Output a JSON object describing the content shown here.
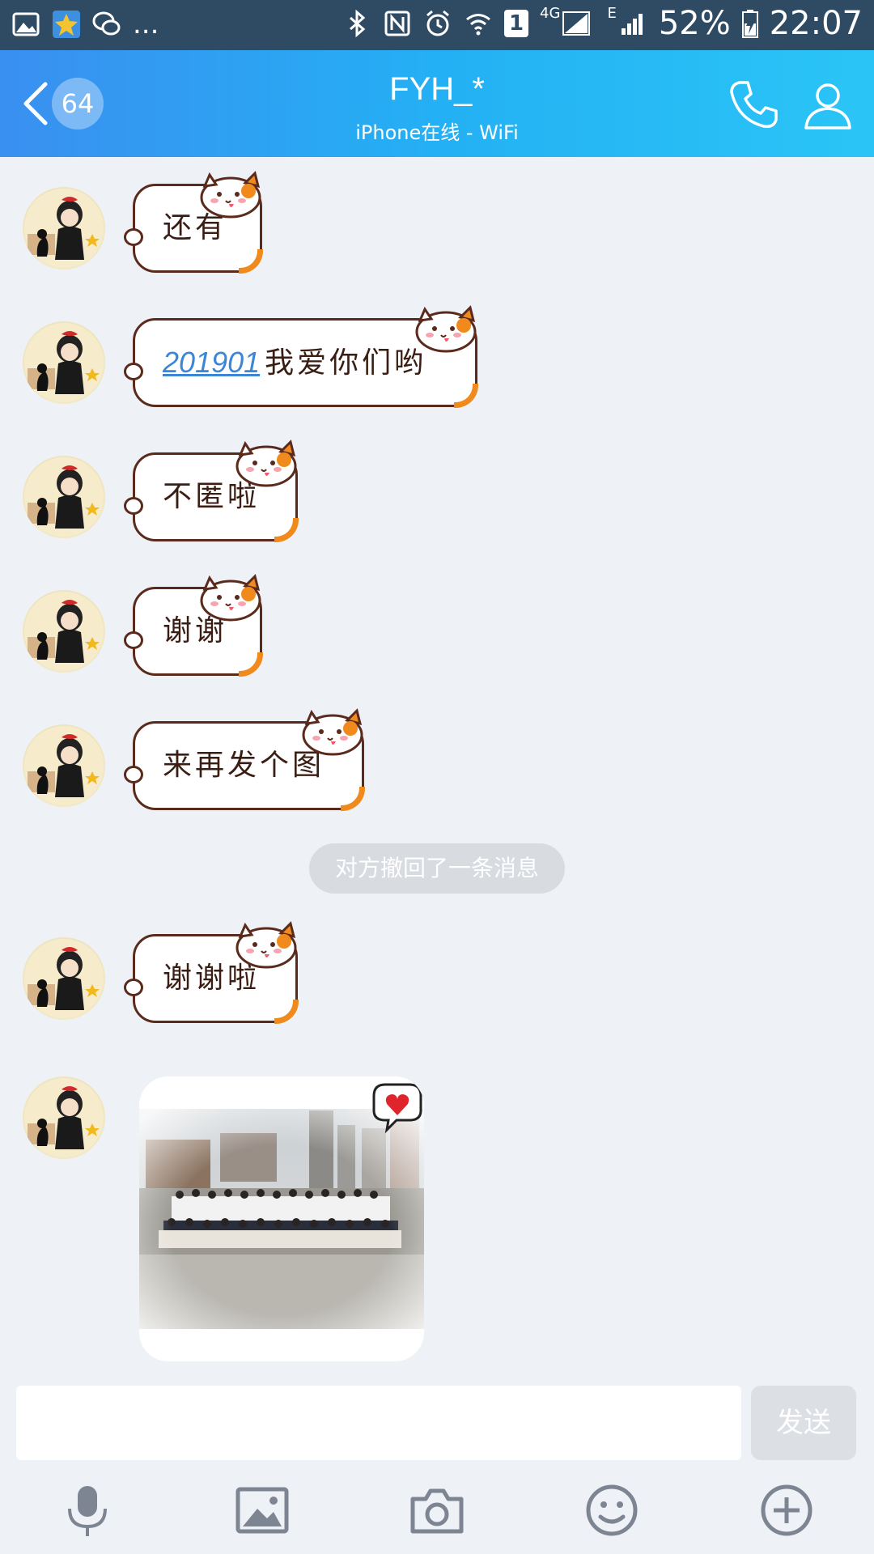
{
  "status_bar": {
    "left_ellipsis": "...",
    "battery_percent": "52%",
    "time": "22:07",
    "network_4g": "4G",
    "network_e": "E",
    "sim_slot": "1",
    "icons": [
      "gallery-icon",
      "starred-app-icon",
      "wechat-icon",
      "bluetooth-icon",
      "nfc-icon",
      "alarm-icon",
      "wifi-icon",
      "signal-icon",
      "battery-icon"
    ]
  },
  "header": {
    "unread_count": "64",
    "title": "FYH_*",
    "subtitle": "iPhone在线 - WiFi",
    "icons": [
      "back-icon",
      "phone-icon",
      "profile-icon"
    ],
    "gradient": [
      "#3a8ff0",
      "#2ac5f6"
    ]
  },
  "messages": [
    {
      "type": "text",
      "text": "还有"
    },
    {
      "type": "text",
      "link": "201901",
      "text": "我爱你们哟"
    },
    {
      "type": "text",
      "text": "不匿啦"
    },
    {
      "type": "text",
      "text": "谢谢"
    },
    {
      "type": "text",
      "text": "来再发个图"
    },
    {
      "type": "system",
      "text": "对方撤回了一条消息"
    },
    {
      "type": "text",
      "text": "谢谢啦"
    },
    {
      "type": "image",
      "caption": ""
    }
  ],
  "input_bar": {
    "placeholder": "",
    "send_label": "发送",
    "tools": [
      "microphone-icon",
      "image-icon",
      "camera-icon",
      "emoji-icon",
      "plus-icon"
    ]
  },
  "colors": {
    "background": "#eef1f6",
    "bubble_border": "#5a2a1c",
    "bubble_accent": "#f08a1c",
    "link": "#3b86d6"
  }
}
